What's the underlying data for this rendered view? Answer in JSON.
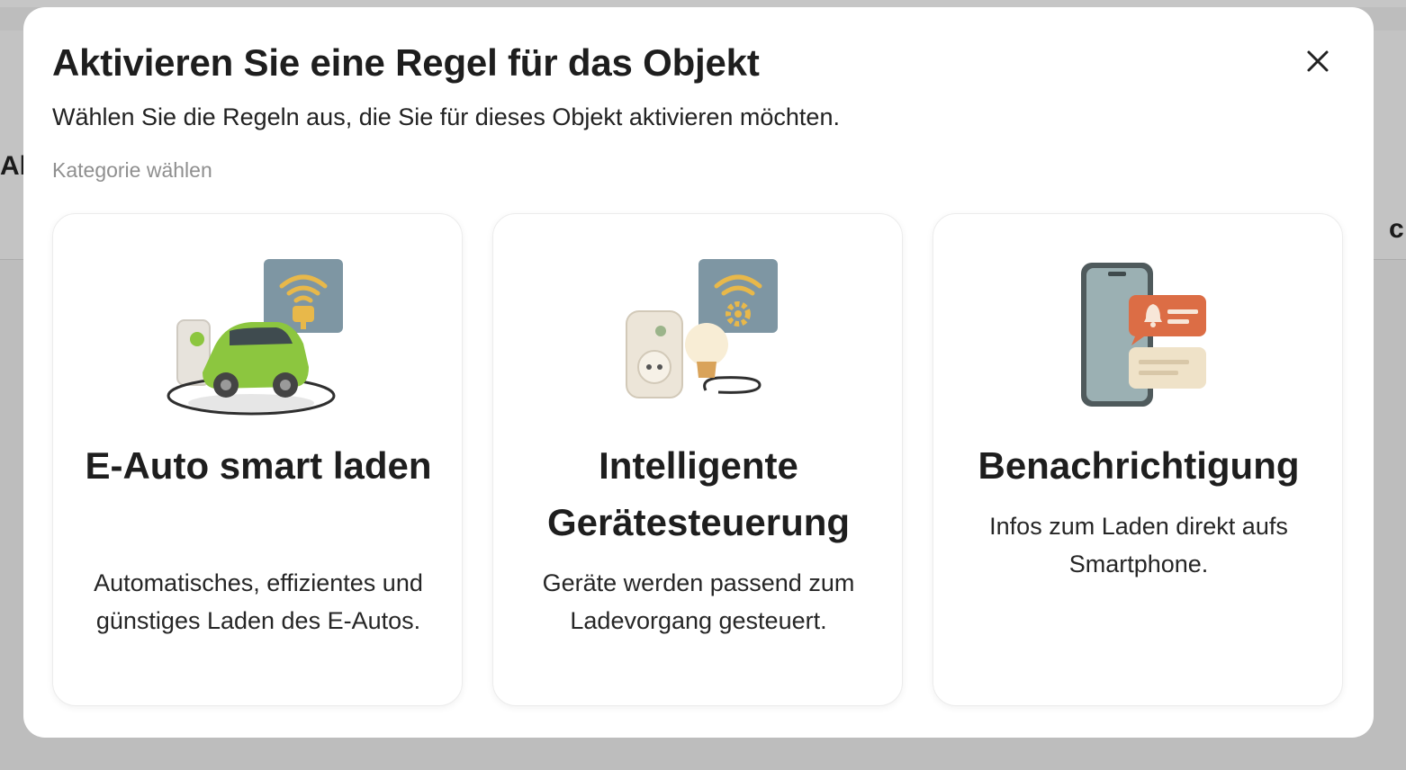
{
  "background": {
    "left_fragment": "Al",
    "right_fragment": "c"
  },
  "modal": {
    "title": "Aktivieren Sie eine Regel für das Objekt",
    "subtitle": "Wählen Sie die Regeln aus, die Sie für dieses Objekt aktivieren möchten.",
    "category_label": "Kategorie wählen",
    "close_icon": "close-icon"
  },
  "cards": [
    {
      "title": "E-Auto smart laden",
      "description": "Automatisches, effizientes und günstiges Laden des E-Autos.",
      "icon": "ev-charging-icon"
    },
    {
      "title": "Intelligente Gerätesteuerung",
      "description": "Geräte werden passend zum Ladevorgang gesteuert.",
      "icon": "smart-plug-icon"
    },
    {
      "title": "Benachrichtigung",
      "description": "Infos zum Laden direkt aufs Smartphone.",
      "icon": "smartphone-notification-icon"
    }
  ],
  "colors": {
    "overlay": "#bdbdbd",
    "card_border": "#ececec",
    "tile_blue": "#7e96a3",
    "wifi_gold": "#e8b84a",
    "car_green": "#8cc63f",
    "notification_orange": "#dc6d45"
  }
}
